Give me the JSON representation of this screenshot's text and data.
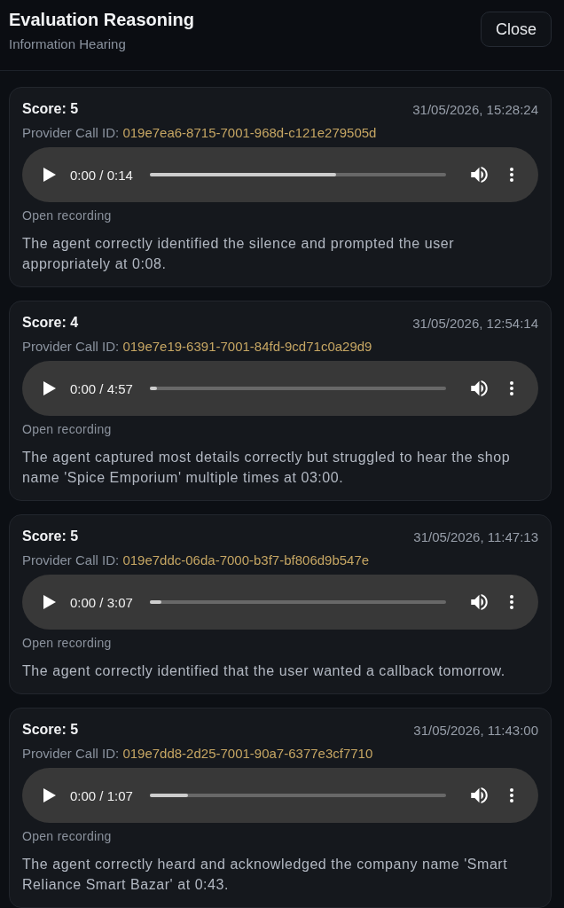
{
  "header": {
    "title": "Evaluation Reasoning",
    "subtitle": "Information Hearing",
    "close_button": "Close"
  },
  "evaluations": [
    {
      "score": "Score: 5",
      "timestamp": "31/05/2026, 15:28:24",
      "call_id_label": "Provider Call ID:",
      "call_id": "019e7ea6-8715-7001-968d-c121e279505d",
      "player": {
        "time": "0:00 / 0:14",
        "level": 0.63
      },
      "link": "Open recording",
      "reasoning": "The agent correctly identified the silence and prompted the user appropriately at 0:08."
    },
    {
      "score": "Score: 4",
      "timestamp": "31/05/2026, 12:54:14",
      "call_id_label": "Provider Call ID:",
      "call_id": "019e7e19-6391-7001-84fd-9cd71c0a29d9",
      "player": {
        "time": "0:00 / 4:57",
        "level": 0.025
      },
      "link": "Open recording",
      "reasoning": "The agent captured most details correctly but struggled to hear the shop name 'Spice Emporium' multiple times at 03:00."
    },
    {
      "score": "Score: 5",
      "timestamp": "31/05/2026, 11:47:13",
      "call_id_label": "Provider Call ID:",
      "call_id": "019e7ddc-06da-7000-b3f7-bf806d9b547e",
      "player": {
        "time": "0:00 / 3:07",
        "level": 0.04
      },
      "link": "Open recording",
      "reasoning": "The agent correctly identified that the user wanted a callback tomorrow."
    },
    {
      "score": "Score: 5",
      "timestamp": "31/05/2026, 11:43:00",
      "call_id_label": "Provider Call ID:",
      "call_id": "019e7dd8-2d25-7001-90a7-6377e3cf7710",
      "player": {
        "time": "0:00 / 1:07",
        "level": 0.13
      },
      "link": "Open recording",
      "reasoning": "The agent correctly heard and acknowledged the company name 'Smart Reliance Smart Bazar' at 0:43."
    }
  ]
}
